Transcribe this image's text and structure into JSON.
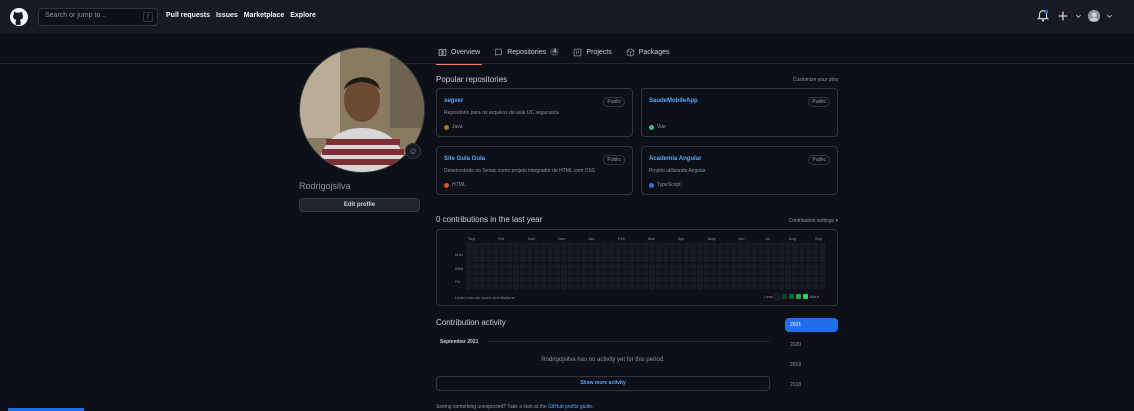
{
  "header": {
    "search_placeholder": "Search or jump to...",
    "search_shortcut": "/",
    "nav": [
      "Pull requests",
      "Issues",
      "Marketplace",
      "Explore"
    ],
    "icons": [
      "notification-bell-icon",
      "plus-icon",
      "avatar"
    ]
  },
  "tabs": [
    {
      "label": "Overview",
      "icon": "book-icon",
      "active": true
    },
    {
      "label": "Repositories",
      "count": "4",
      "icon": "repo-icon"
    },
    {
      "label": "Projects",
      "icon": "project-icon"
    },
    {
      "label": "Packages",
      "icon": "package-icon"
    }
  ],
  "profile": {
    "username": "Rodrigojsilva",
    "edit_label": "Edit profile",
    "status_icon": "smiley-icon"
  },
  "popular": {
    "title": "Popular repositories",
    "customize": "Customize your pins",
    "repos": [
      {
        "name": "segver",
        "visibility": "Public",
        "description": "Repositorio para os arquivos da aula UC seguranca",
        "language": "Java",
        "color": "#b07219"
      },
      {
        "name": "SaudeMobileApp",
        "visibility": "Public",
        "description": "",
        "language": "Vue",
        "color": "#41b883"
      },
      {
        "name": "Site Gula Gula",
        "visibility": "Public",
        "description": "Desenvolvido no Senac como projeto integrador de HTML com CSS",
        "language": "HTML",
        "color": "#e34c26"
      },
      {
        "name": "Academia Angular",
        "visibility": "Public",
        "description": "Projeto utilizando Angular",
        "language": "TypeScript",
        "color": "#3178c6"
      }
    ]
  },
  "contrib": {
    "title": "0 contributions in the last year",
    "settings": "Contribution settings ▾",
    "months": [
      "Sep",
      "Oct",
      "Nov",
      "Dec",
      "Jan",
      "Feb",
      "Mar",
      "Apr",
      "May",
      "Jun",
      "Jul",
      "Aug",
      "Sep"
    ],
    "days": [
      "Mon",
      "Wed",
      "Fri"
    ],
    "learn": "Learn how we count contributions",
    "less": "Less",
    "more": "More",
    "legend_colors": [
      "#161b22",
      "#0e4429",
      "#006d32",
      "#26a641",
      "#39d353"
    ]
  },
  "activity": {
    "title": "Contribution activity",
    "month": "September 2021",
    "empty": "Rodrigojsilva has no activity yet for this period.",
    "more_label": "Show more activity",
    "years": [
      "2021",
      "2020",
      "2019",
      "2018"
    ]
  },
  "footer_note": {
    "text": "Seeing something unexpected? Take a look at the",
    "link": "GitHub profile guide."
  }
}
